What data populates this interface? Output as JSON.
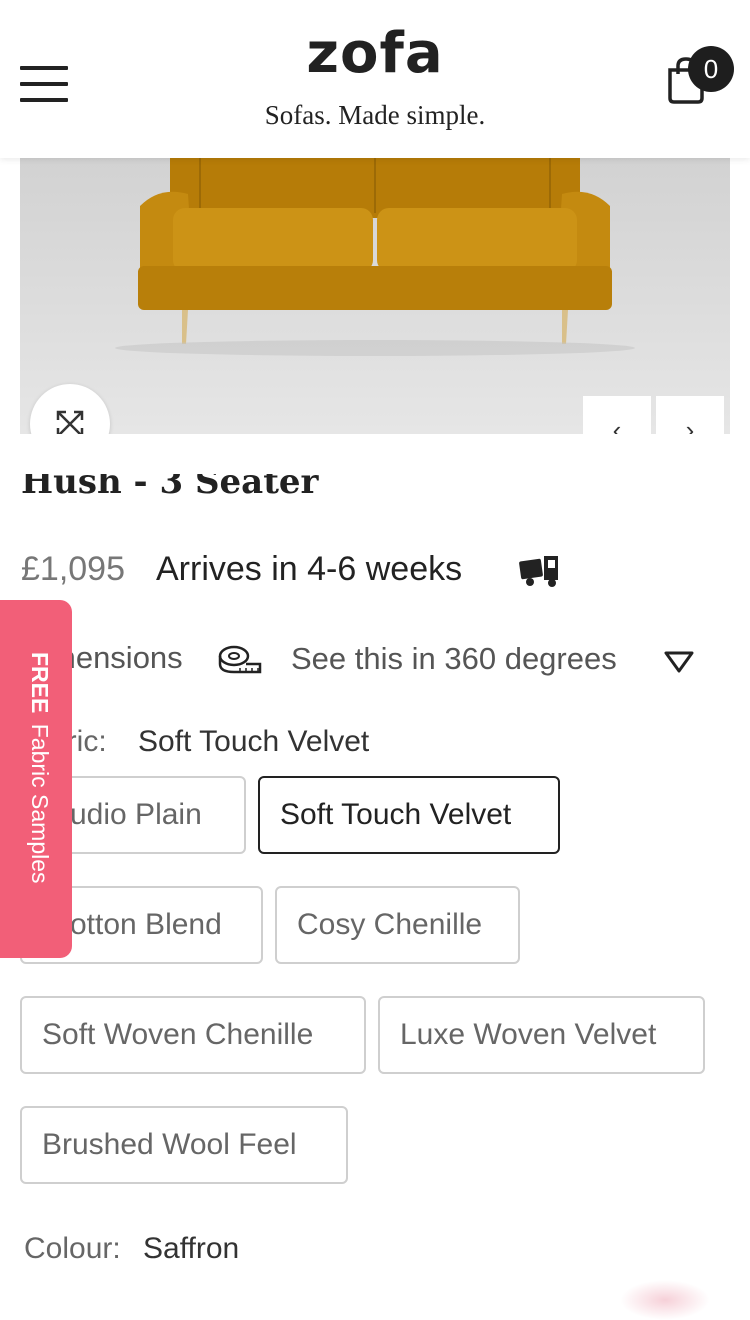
{
  "header": {
    "logo": "zofa",
    "tagline": "Sofas. Made simple.",
    "cart_count": "0",
    "menu_icon": "hamburger-menu-icon",
    "cart_icon": "shopping-bag-icon"
  },
  "gallery": {
    "expand_icon": "expand-arrows-icon",
    "prev_icon": "chevron-left-icon",
    "next_icon": "chevron-right-icon",
    "prev_label": "‹",
    "next_label": "›",
    "sofa_color": "#c48a10"
  },
  "product": {
    "title": "Hush - 3 Seater",
    "price": "£1,095",
    "arrives": "Arrives in 4-6 weeks",
    "delivery_icon": "delivery-truck-icon"
  },
  "links": {
    "dimensions": "mensions",
    "dimensions_icon": "tape-measure-icon",
    "view_360": "See this in 360 degrees",
    "view_360_icon": "triangle-down-icon"
  },
  "fabric": {
    "label": "oric:",
    "value": "Soft Touch Velvet",
    "options": [
      {
        "label": "udio Plain"
      },
      {
        "label": "Soft Touch Velvet",
        "selected": true
      },
      {
        "label": "otton Blend"
      },
      {
        "label": "Cosy Chenille"
      },
      {
        "label": "Soft Woven Chenille"
      },
      {
        "label": "Luxe Woven Velvet"
      },
      {
        "label": "Brushed Wool Feel"
      }
    ]
  },
  "colour": {
    "label": "Colour:",
    "value": "Saffron"
  },
  "samples_tab": {
    "bold": "FREE",
    "text": "Fabric Samples",
    "color": "#f25f78"
  }
}
